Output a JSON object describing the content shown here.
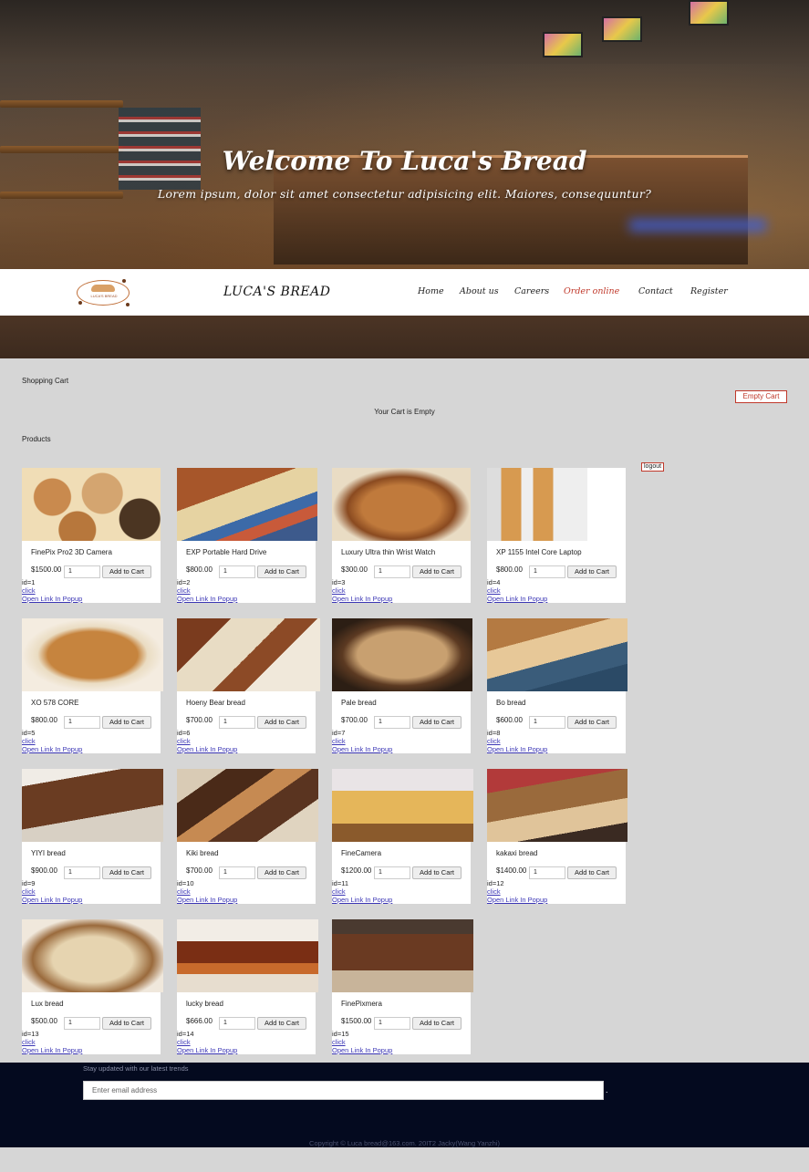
{
  "hero": {
    "title": "Welcome To Luca's Bread",
    "tagline": "Lorem ipsum, dolor sit amet consectetur adipisicing elit. Maiores, consequuntur?"
  },
  "nav": {
    "brand": "LUCA'S BREAD",
    "logo_text": "LUCA'S BREAD",
    "links": [
      "Home",
      "About us",
      "Careers",
      "Order online",
      "Contact",
      "Register"
    ],
    "active": "Order online"
  },
  "cart": {
    "title": "Shopping Cart",
    "empty_button": "Empty Cart",
    "empty_message": "Your Cart is Empty"
  },
  "products_title": "Products",
  "logout_label": "logout",
  "add_label": "Add to Cart",
  "click_label": "click",
  "popup_label": "Open Link In Popup",
  "products": [
    {
      "name": "FinePix Pro2 3D Camera",
      "price": "$1500.00",
      "qty": "1",
      "id": "id=1"
    },
    {
      "name": "EXP Portable Hard Drive",
      "price": "$800.00",
      "qty": "1",
      "id": "id=2"
    },
    {
      "name": "Luxury Ultra thin Wrist Watch",
      "price": "$300.00",
      "qty": "1",
      "id": "id=3"
    },
    {
      "name": "XP 1155 Intel Core Laptop",
      "price": "$800.00",
      "qty": "1",
      "id": "id=4"
    },
    {
      "name": "XO 578 CORE",
      "price": "$800.00",
      "qty": "1",
      "id": "id=5"
    },
    {
      "name": "Hoeny Bear bread",
      "price": "$700.00",
      "qty": "1",
      "id": "id=6"
    },
    {
      "name": "Pale bread",
      "price": "$700.00",
      "qty": "1",
      "id": "id=7"
    },
    {
      "name": "Bo bread",
      "price": "$600.00",
      "qty": "1",
      "id": "id=8"
    },
    {
      "name": "YIYI bread",
      "price": "$900.00",
      "qty": "1",
      "id": "id=9"
    },
    {
      "name": "Kiki bread",
      "price": "$700.00",
      "qty": "1",
      "id": "id=10"
    },
    {
      "name": "FineCamera",
      "price": "$1200.00",
      "qty": "1",
      "id": "id=11"
    },
    {
      "name": "kakaxi bread",
      "price": "$1400.00",
      "qty": "1",
      "id": "id=12"
    },
    {
      "name": "Lux bread",
      "price": "$500.00",
      "qty": "1",
      "id": "id=13"
    },
    {
      "name": "lucky bread",
      "price": "$666.00",
      "qty": "1",
      "id": "id=14"
    },
    {
      "name": "FinePixmera",
      "price": "$1500.00",
      "qty": "1",
      "id": "id=15"
    }
  ],
  "footer": {
    "stay_text": "Stay updated with our latest trends",
    "email_placeholder": "Enter email address",
    "dot": ".",
    "copyright": "Copyright © Luca bread@163.com.    20IT2 Jacky(Wang Yanzhi)"
  }
}
